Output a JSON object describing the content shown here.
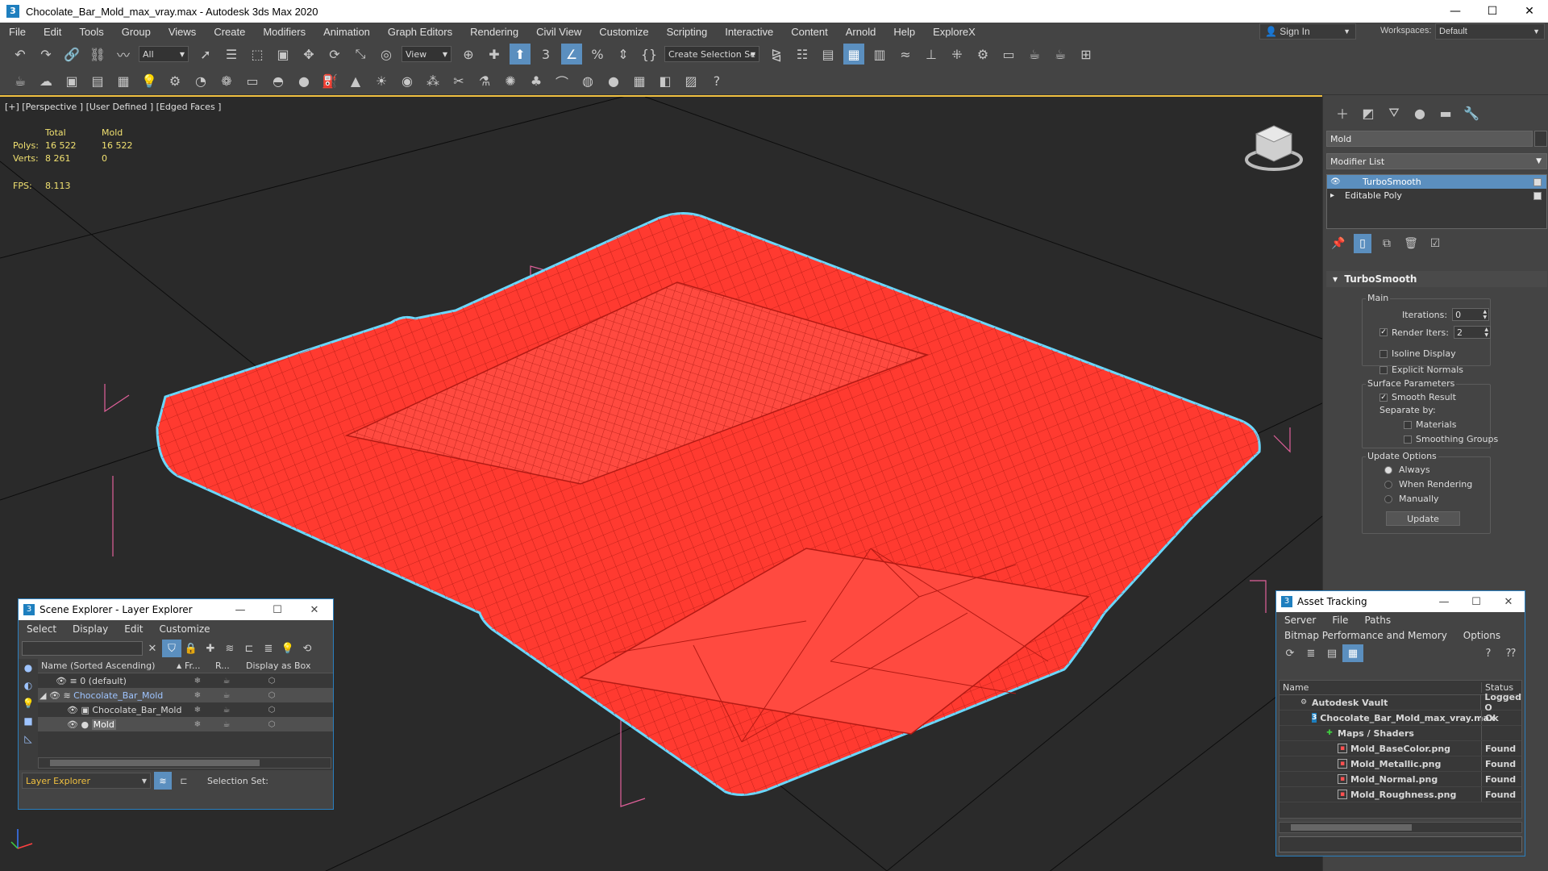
{
  "window": {
    "title": "Chocolate_Bar_Mold_max_vray.max - Autodesk 3ds Max 2020",
    "app_icon": "3",
    "minimize": "—",
    "maximize": "☐",
    "close": "✕"
  },
  "menu": {
    "items": [
      "File",
      "Edit",
      "Tools",
      "Group",
      "Views",
      "Create",
      "Modifiers",
      "Animation",
      "Graph Editors",
      "Rendering",
      "Civil View",
      "Customize",
      "Scripting",
      "Interactive",
      "Content",
      "Arnold",
      "Help",
      "ExploreX"
    ],
    "sign_in": "Sign In",
    "workspaces_label": "Workspaces:",
    "workspace_value": "Default"
  },
  "toolbar": {
    "selection_filter": "All",
    "ref_coord": "View",
    "named_selection": "Create Selection Se"
  },
  "viewport": {
    "label": "[+] [Perspective ] [User Defined ] [Edged Faces ]",
    "stats": {
      "col_total": "Total",
      "col_obj": "Mold",
      "polys_label": "Polys:",
      "polys_total": "16 522",
      "polys_obj": "16 522",
      "verts_label": "Verts:",
      "verts_total": "8 261",
      "verts_obj": "0",
      "fps_label": "FPS:",
      "fps_value": "8.113"
    },
    "mesh_color": "#ff3a30",
    "outline_color": "#6ad8ff"
  },
  "command_panel": {
    "object_name": "Mold",
    "modifier_list": "Modifier List",
    "stack": [
      "TurboSmooth",
      "Editable Poly"
    ],
    "rollout_title": "TurboSmooth",
    "main_group": "Main",
    "iterations_label": "Iterations:",
    "iterations_value": "0",
    "render_iters_label": "Render Iters:",
    "render_iters_value": "2",
    "isoline": "Isoline Display",
    "explicit_normals": "Explicit Normals",
    "surface_group": "Surface Parameters",
    "smooth_result": "Smooth Result",
    "separate_by": "Separate by:",
    "materials": "Materials",
    "smoothing_groups": "Smoothing Groups",
    "update_group": "Update Options",
    "always": "Always",
    "when_rendering": "When Rendering",
    "manually": "Manually",
    "update_button": "Update"
  },
  "scene_explorer": {
    "title": "Scene Explorer - Layer Explorer",
    "menu": [
      "Select",
      "Display",
      "Edit",
      "Customize"
    ],
    "columns": {
      "name": "Name (Sorted Ascending)",
      "fr": "Fr...",
      "r": "R...",
      "box": "Display as Box"
    },
    "rows": [
      "0 (default)",
      "Chocolate_Bar_Mold",
      "Chocolate_Bar_Mold",
      "Mold"
    ],
    "footer_select": "Layer Explorer",
    "selection_set": "Selection Set:"
  },
  "asset_tracking": {
    "title": "Asset Tracking",
    "menu1": [
      "Server",
      "File",
      "Paths"
    ],
    "menu2": [
      "Bitmap Performance and Memory",
      "Options"
    ],
    "columns": {
      "name": "Name",
      "status": "Status"
    },
    "rows": [
      {
        "name": "Autodesk Vault",
        "status": "Logged O"
      },
      {
        "name": "Chocolate_Bar_Mold_max_vray.max",
        "status": "Ok"
      },
      {
        "name": "Maps / Shaders",
        "status": ""
      },
      {
        "name": "Mold_BaseColor.png",
        "status": "Found"
      },
      {
        "name": "Mold_Metallic.png",
        "status": "Found"
      },
      {
        "name": "Mold_Normal.png",
        "status": "Found"
      },
      {
        "name": "Mold_Roughness.png",
        "status": "Found"
      }
    ]
  }
}
